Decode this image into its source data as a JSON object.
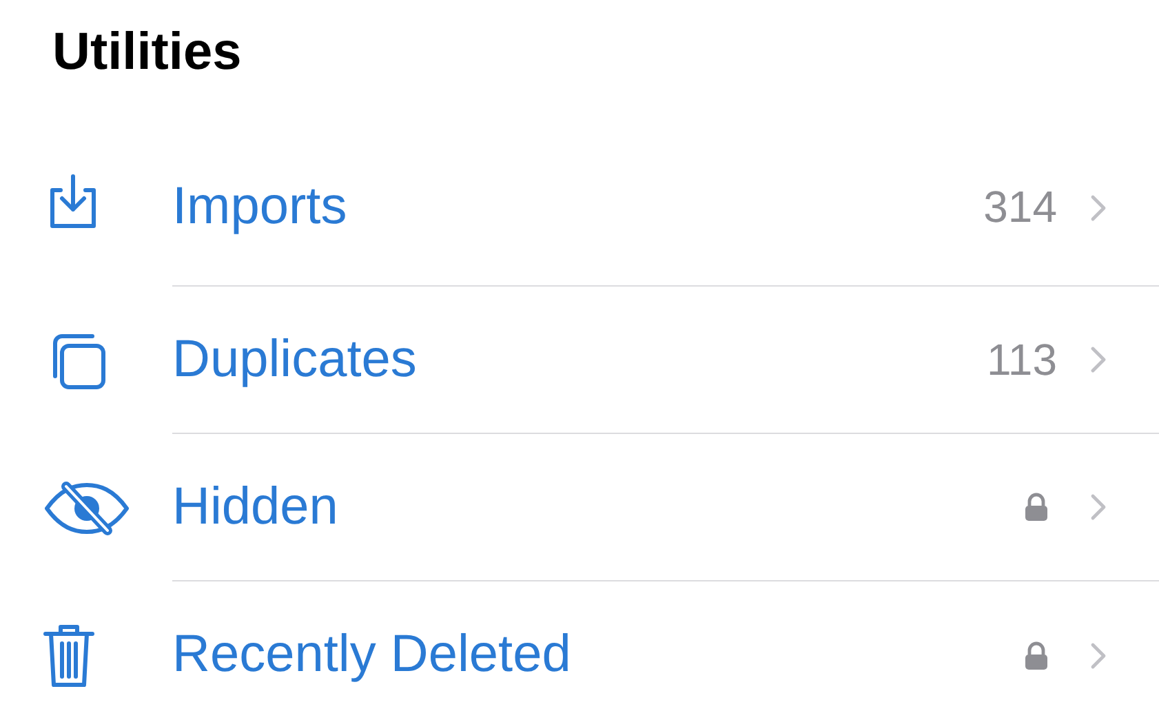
{
  "section": {
    "title": "Utilities"
  },
  "rows": [
    {
      "label": "Imports",
      "kind": "count",
      "count": "314"
    },
    {
      "label": "Duplicates",
      "kind": "count",
      "count": "113"
    },
    {
      "label": "Hidden",
      "kind": "lock"
    },
    {
      "label": "Recently Deleted",
      "kind": "lock"
    }
  ]
}
